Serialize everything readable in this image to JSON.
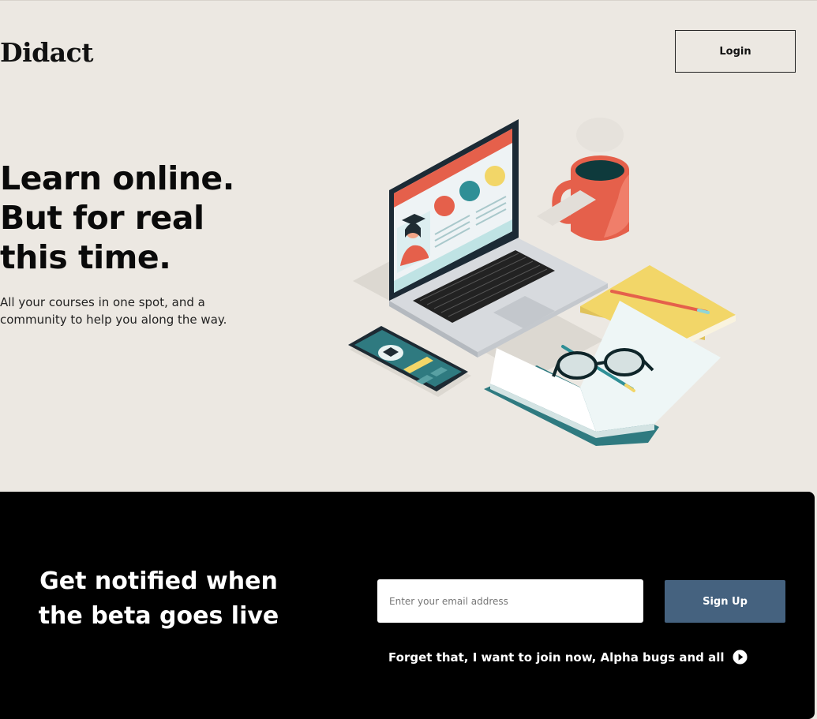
{
  "header": {
    "brand": "Didact",
    "login_label": "Login"
  },
  "hero": {
    "title_lines": [
      "Learn online.",
      "But for real",
      "this time."
    ],
    "subtitle_lines": [
      "All your courses in one spot, and a",
      "community to help you along the way."
    ]
  },
  "signup": {
    "title_lines": [
      "Get notified when",
      "the beta goes live"
    ],
    "email_placeholder": "Enter your email address",
    "button_label": "Sign Up",
    "join_link": "Forget that, I want to join now, Alpha bugs and all"
  },
  "colors": {
    "page_bg": "#ece8e2",
    "band_bg": "#000000",
    "signup_button": "#45627f",
    "laptop_screen_header": "#e5604b",
    "mug": "#e5604b",
    "notebook_yellow": "#f2d668",
    "phone_teal": "#2f7a80"
  },
  "icons": {
    "join_link_icon": "play-circle-icon"
  }
}
